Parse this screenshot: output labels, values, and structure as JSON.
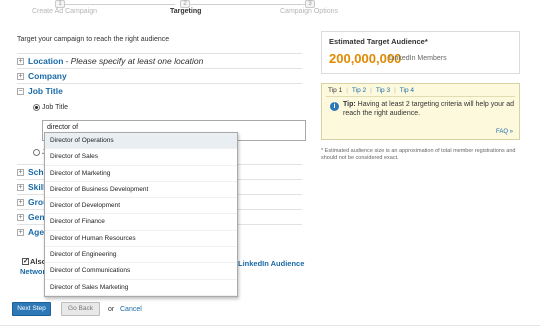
{
  "stepper": {
    "steps": [
      {
        "number": "1",
        "label": "Create Ad Campaign"
      },
      {
        "number": "2",
        "label": "Targeting"
      },
      {
        "number": "3",
        "label": "Campaign Options"
      }
    ]
  },
  "main": {
    "intro": "Target your campaign to reach the right audience",
    "sections": [
      {
        "title": "Location",
        "note": "- Please specify at least one location",
        "toggle": "+"
      },
      {
        "title": "Company",
        "note": "",
        "toggle": "+"
      },
      {
        "title": "Job Title",
        "note": "",
        "toggle": "−"
      },
      {
        "title": "Scho",
        "note": "",
        "toggle": "+"
      },
      {
        "title": "Skills",
        "note": "",
        "toggle": "+"
      },
      {
        "title": "Group",
        "note": "",
        "toggle": "+"
      },
      {
        "title": "Gend",
        "note": "",
        "toggle": "+"
      },
      {
        "title": "Age",
        "note": "",
        "toggle": "+"
      }
    ],
    "job_title": {
      "radio_label": "Job Title",
      "second_radio_label": "J",
      "input_value": "director of",
      "suggestions": [
        "Director of Operations",
        "Director of Sales",
        "Director of Marketing",
        "Director of Business Development",
        "Director of Development",
        "Director of Finance",
        "Director of Human Resources",
        "Director of Engineering",
        "Director of Communications",
        "Director of Sales Marketing"
      ]
    },
    "also_label": "Also",
    "network_label": "Network",
    "audience_link": "LinkedIn Audience",
    "buttons": {
      "next": "Next Step",
      "back": "Go Back",
      "or": "or",
      "cancel": "Cancel"
    }
  },
  "sidebar": {
    "estimate_title": "Estimated Target Audience*",
    "estimate_value": "200,000,000",
    "estimate_unit": "LinkedIn Members",
    "tips": {
      "tabs": [
        "Tip 1",
        "Tip 2",
        "Tip 3",
        "Tip 4"
      ],
      "active_tab": 0,
      "bold": "Tip:",
      "text": "Having at least 2 targeting criteria will help your ad reach the right audience.",
      "faq": "FAQ »"
    },
    "disclaimer": "* Estimated audience size is an approximation of total member registrations and should not be considered exact."
  },
  "colors": {
    "link": "#1a6aa8",
    "accent": "#e08a00",
    "primary_button": "#2d78b7",
    "tip_background": "#fcf9dc"
  },
  "icons": {
    "expand": "plus-box-icon",
    "collapse": "minus-box-icon",
    "tip": "info-icon"
  }
}
